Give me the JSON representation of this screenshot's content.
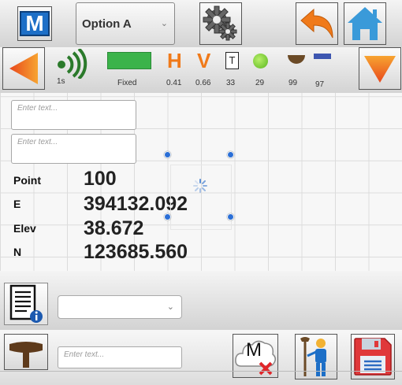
{
  "toolbar": {
    "logo_letter": "M",
    "dropdown_value": "Option A",
    "colors": {
      "accent_orange": "#f07a1a",
      "home_blue": "#3a9ad9",
      "logo_blue": "#1d6fc7",
      "gps_green": "#2b7a2b"
    }
  },
  "status": {
    "gps_interval": "1s",
    "fix_label": "Fixed",
    "h_value": "0.41",
    "v_value": "0.66",
    "t_value": "33",
    "sat_value": "29",
    "battery_value": "99",
    "signal_value": "97"
  },
  "inputs": {
    "placeholder_1": "Enter text...",
    "placeholder_2": "Enter text...",
    "placeholder_bottom": "Enter text..."
  },
  "point": {
    "point_label": "Point",
    "point_value": "100",
    "e_label": "E",
    "e_value": "394132.092",
    "elev_label": "Elev",
    "elev_value": "38.672",
    "n_label": "N",
    "n_value": "123685.560"
  },
  "bottom": {
    "select_value": "",
    "cloud_letter": "M"
  }
}
